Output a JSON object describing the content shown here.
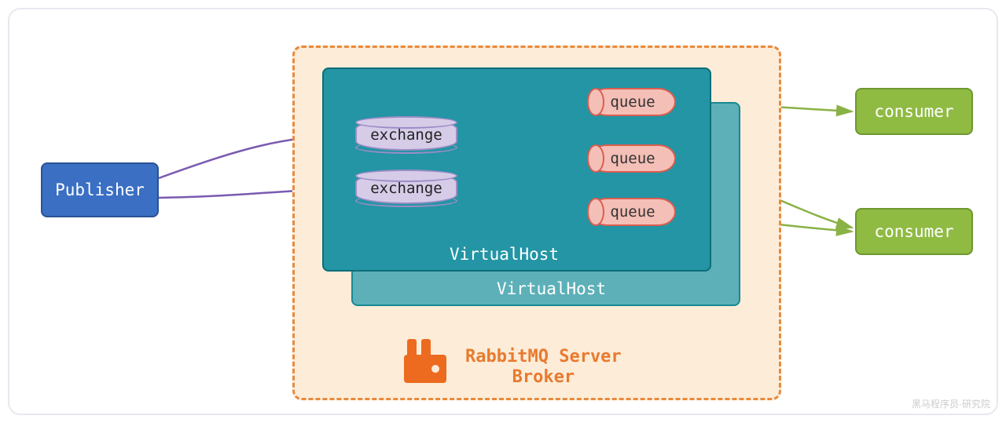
{
  "publisher": {
    "label": "Publisher"
  },
  "consumers": [
    {
      "label": "consumer"
    },
    {
      "label": "consumer"
    }
  ],
  "broker": {
    "title_line1": "RabbitMQ Server",
    "title_line2": "Broker"
  },
  "virtualhosts": [
    {
      "label": "VirtualHost"
    },
    {
      "label": "VirtualHost"
    }
  ],
  "exchanges": [
    {
      "label": "exchange"
    },
    {
      "label": "exchange"
    }
  ],
  "queues": [
    {
      "label": "queue"
    },
    {
      "label": "queue"
    },
    {
      "label": "queue"
    }
  ],
  "watermark": "黑马程序员·研究院",
  "colors": {
    "publisher": "#3a6fc3",
    "consumer": "#8fbb43",
    "broker_border": "#e88a3d",
    "broker_bg": "#fcecd8",
    "vhost_front": "#2395a4",
    "vhost_back": "#5db0b8",
    "exchange": "#d6cce8",
    "queue": "#f4bfb6",
    "arrow_purple": "#7a5ab0",
    "arrow_orange": "#ed9536",
    "arrow_green": "#8ab244"
  }
}
